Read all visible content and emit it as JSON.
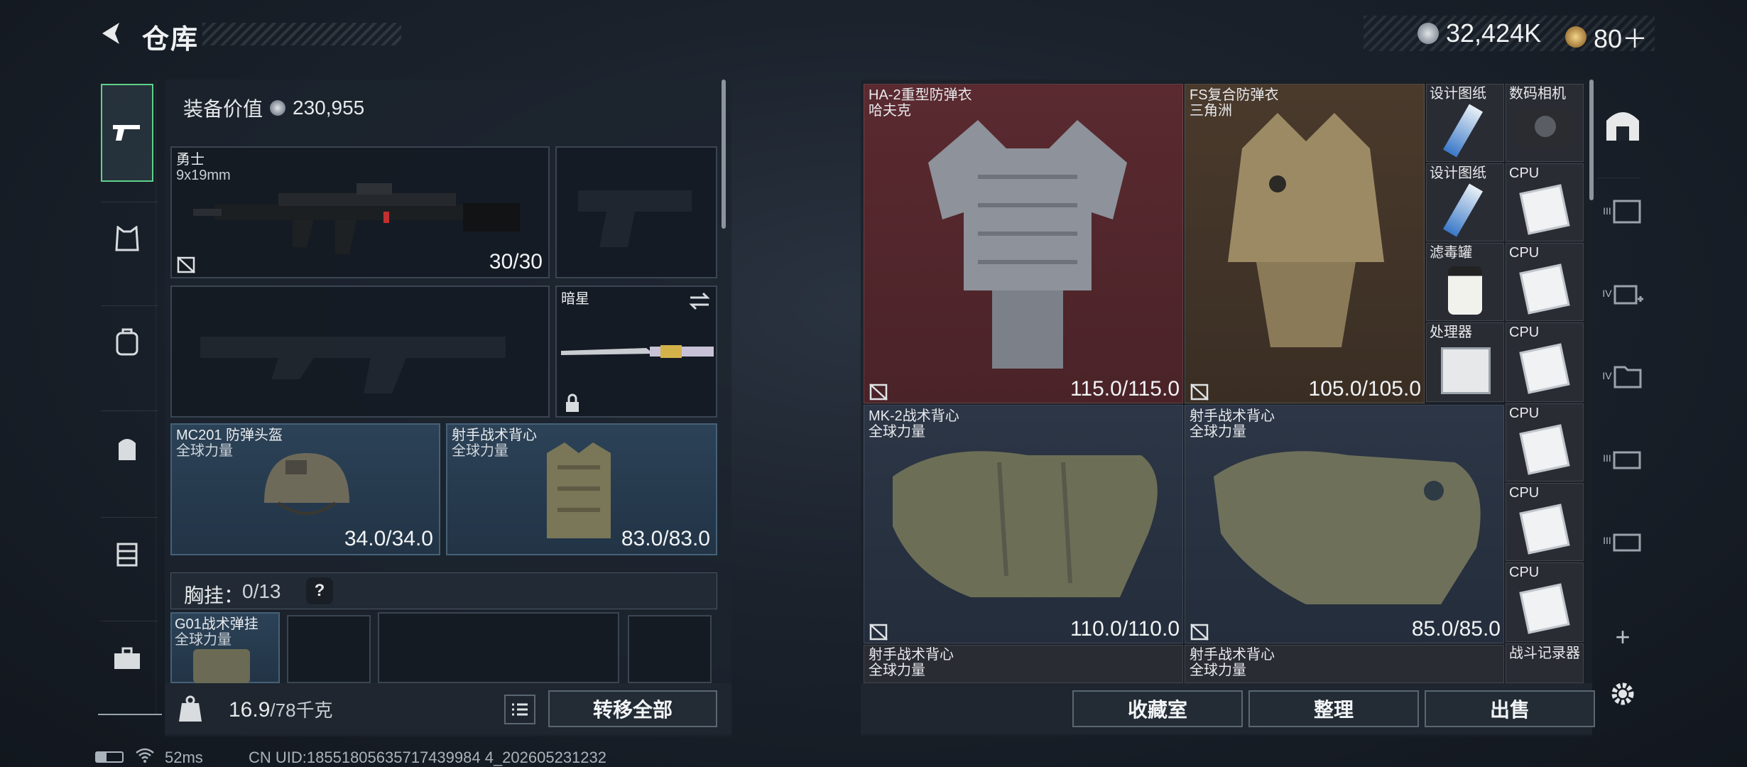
{
  "header": {
    "title": "仓库",
    "currency1": "32,424K",
    "currency2": "80＋",
    "coin1_color": "#b8bec6",
    "coin2_color": "#c9a15a"
  },
  "left_nav": [
    "gun-icon",
    "vest-icon",
    "helmet-icon",
    "backpack-icon",
    "rig-icon",
    "toolbox-icon"
  ],
  "equipment": {
    "value_label": "装备价值",
    "value": "230,955",
    "primary": {
      "name": "勇士",
      "sub": "9x19mm",
      "ammo": "30/30"
    },
    "melee": {
      "name": "暗星"
    },
    "helmet": {
      "name": "MC201 防弹头盔",
      "sub": "全球力量",
      "value": "34.0/34.0"
    },
    "armor": {
      "name": "射手战术背心",
      "sub": "全球力量",
      "value": "83.0/83.0"
    },
    "chest_rig_label": "胸挂：",
    "chest_rig_count": "0/13",
    "help": "?",
    "rig_item": {
      "name": "G01战术弹挂",
      "sub": "全球力量"
    }
  },
  "footer_left": {
    "weight": "16.9",
    "weight_max": "/78千克",
    "transfer_all": "转移全部"
  },
  "stash": {
    "items": [
      {
        "name": "HA-2重型防弹衣",
        "sub": "哈夫克",
        "value": "115.0/115.0"
      },
      {
        "name": "FS复合防弹衣",
        "sub": "三角洲",
        "value": "105.0/105.0"
      },
      {
        "name": "MK-2战术背心",
        "sub": "全球力量",
        "value": "110.0/110.0"
      },
      {
        "name": "射手战术背心",
        "sub": "全球力量",
        "value": "85.0/85.0"
      },
      {
        "name": "射手战术背心",
        "sub": "全球力量"
      },
      {
        "name": "射手战术背心",
        "sub": "全球力量"
      }
    ],
    "small": [
      {
        "name": "设计图纸"
      },
      {
        "name": "数码相机"
      },
      {
        "name": "设计图纸"
      },
      {
        "name": "CPU"
      },
      {
        "name": "滤毒罐"
      },
      {
        "name": "CPU"
      },
      {
        "name": "处理器"
      },
      {
        "name": "CPU"
      },
      {
        "name": "CPU"
      },
      {
        "name": "CPU"
      },
      {
        "name": "CPU"
      },
      {
        "name": "战斗记录器"
      }
    ]
  },
  "footer_right": {
    "collection": "收藏室",
    "sort": "整理",
    "sell": "出售"
  },
  "right_nav": {
    "plus": "+",
    "tiers": [
      "III",
      "IV",
      "IV",
      "III",
      "III"
    ]
  },
  "status": {
    "ping": "52ms",
    "uid": "CN UID:18551805635717439984 4_202605231232"
  }
}
